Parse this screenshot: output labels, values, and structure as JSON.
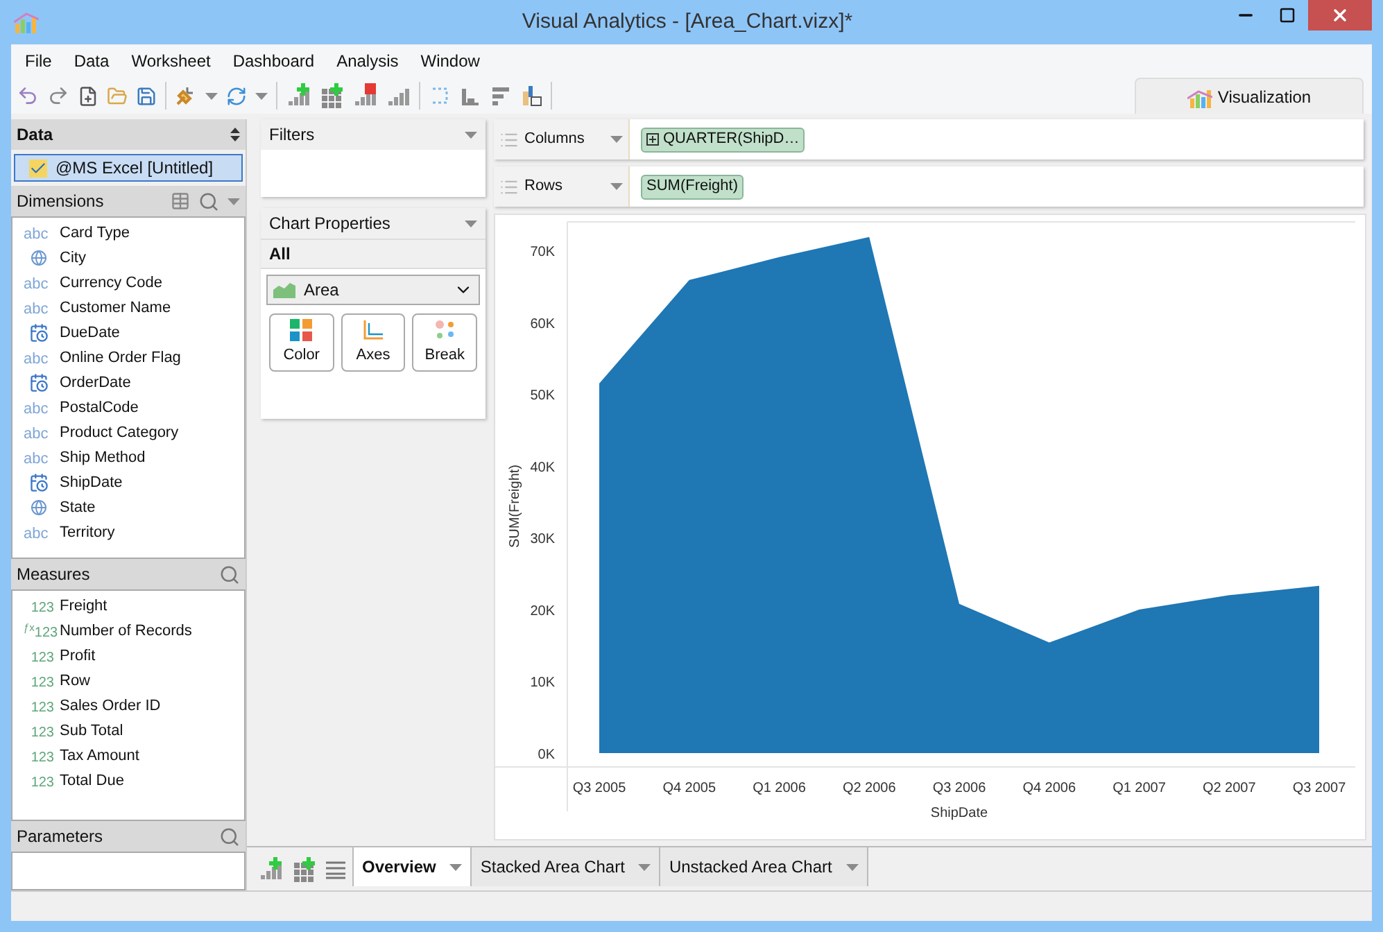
{
  "window": {
    "title": "Visual Analytics - [Area_Chart.vizx]*"
  },
  "menu": [
    "File",
    "Data",
    "Worksheet",
    "Dashboard",
    "Analysis",
    "Window"
  ],
  "visualization_tab": {
    "label": "Visualization"
  },
  "data_panel": {
    "title": "Data",
    "source": {
      "label": "@MS Excel [Untitled]",
      "selected": true
    }
  },
  "dimensions": {
    "title": "Dimensions",
    "items": [
      {
        "kind": "text",
        "type_label": "abc",
        "label": "Card Type"
      },
      {
        "kind": "geo",
        "label": "City"
      },
      {
        "kind": "text",
        "type_label": "abc",
        "label": "Currency Code"
      },
      {
        "kind": "text",
        "type_label": "abc",
        "label": "Customer Name"
      },
      {
        "kind": "date",
        "label": "DueDate"
      },
      {
        "kind": "text",
        "type_label": "abc",
        "label": "Online Order Flag"
      },
      {
        "kind": "date",
        "label": "OrderDate"
      },
      {
        "kind": "text",
        "type_label": "abc",
        "label": "PostalCode"
      },
      {
        "kind": "text",
        "type_label": "abc",
        "label": "Product Category"
      },
      {
        "kind": "text",
        "type_label": "abc",
        "label": "Ship Method"
      },
      {
        "kind": "date",
        "label": "ShipDate"
      },
      {
        "kind": "geo",
        "label": "State"
      },
      {
        "kind": "text",
        "type_label": "abc",
        "label": "Territory"
      }
    ]
  },
  "measures": {
    "title": "Measures",
    "items": [
      {
        "kind": "number",
        "type_label": "123",
        "label": "Freight"
      },
      {
        "kind": "calc",
        "type_label": "$^{ƒx}$123",
        "label": "Number of Records"
      },
      {
        "kind": "number",
        "type_label": "123",
        "label": "Profit"
      },
      {
        "kind": "number",
        "type_label": "123",
        "label": "Row"
      },
      {
        "kind": "number",
        "type_label": "123",
        "label": "Sales Order ID"
      },
      {
        "kind": "number",
        "type_label": "123",
        "label": "Sub Total"
      },
      {
        "kind": "number",
        "type_label": "123",
        "label": "Tax Amount"
      },
      {
        "kind": "number",
        "type_label": "123",
        "label": "Total Due"
      }
    ]
  },
  "parameters": {
    "title": "Parameters"
  },
  "filters": {
    "title": "Filters"
  },
  "chart_properties": {
    "title": "Chart Properties",
    "section": "All",
    "mark_type": "Area",
    "buttons": [
      "Color",
      "Axes",
      "Break"
    ]
  },
  "shelves": [
    {
      "label": "Columns",
      "pill": "QUARTER(ShipD…",
      "expandable": true
    },
    {
      "label": "Rows",
      "pill": "SUM(Freight)",
      "expandable": false
    }
  ],
  "chart": {
    "chart_data": {
      "type": "area",
      "xlabel": "ShipDate",
      "ylabel": "SUM(Freight)",
      "categories": [
        "Q3 2005",
        "Q4 2005",
        "Q1 2006",
        "Q2 2006",
        "Q3 2006",
        "Q4 2006",
        "Q1 2007",
        "Q2 2007",
        "Q3 2007"
      ],
      "series": [
        {
          "color": "#1f77b4",
          "values": [
            51500,
            65900,
            69100,
            71900,
            20800,
            15400,
            20000,
            22000,
            23300
          ]
        }
      ],
      "ylim": [
        0,
        74000
      ],
      "yticks": [
        {
          "value": 0,
          "label": "0K"
        },
        {
          "value": 10000,
          "label": "10K"
        },
        {
          "value": 20000,
          "label": "20K"
        },
        {
          "value": 30000,
          "label": "30K"
        },
        {
          "value": 40000,
          "label": "40K"
        },
        {
          "value": 50000,
          "label": "50K"
        },
        {
          "value": 60000,
          "label": "60K"
        },
        {
          "value": 70000,
          "label": "70K"
        }
      ]
    }
  },
  "sheet_tabs": [
    {
      "label": "Overview",
      "selected": true
    },
    {
      "label": "Stacked Area Chart",
      "selected": false
    },
    {
      "label": "Unstacked Area Chart",
      "selected": false
    }
  ]
}
